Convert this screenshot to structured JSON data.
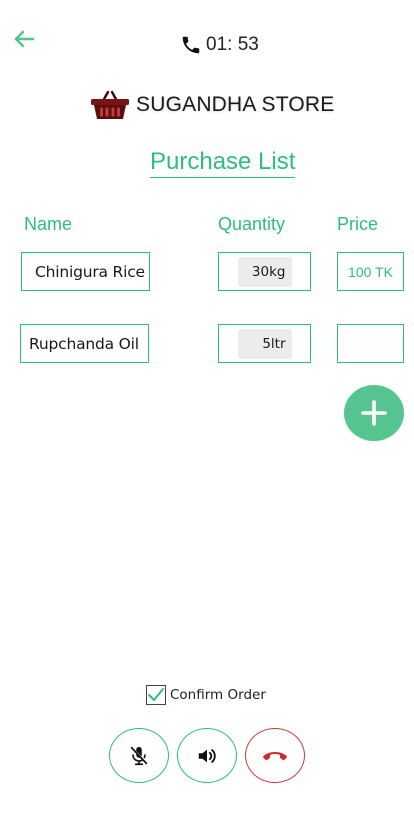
{
  "header": {
    "back_icon": "arrow-left-icon",
    "phone_icon": "phone-icon",
    "call_time": "01: 53"
  },
  "store": {
    "logo_icon": "shopping-basket-icon",
    "name": "SUGANDHA STORE"
  },
  "list": {
    "title": "Purchase List",
    "columns": [
      "Name",
      "Quantity",
      "Price"
    ],
    "items": [
      {
        "name": "Chinigura Rice",
        "quantity": "30kg",
        "price": "100 TK"
      },
      {
        "name": "Rupchanda Oil",
        "quantity": "5ltr",
        "price": ""
      }
    ],
    "add_icon": "plus-icon"
  },
  "confirm": {
    "label": "Confirm Order",
    "checked": true
  },
  "controls": {
    "mute_icon": "mic-off-icon",
    "speaker_icon": "speaker-icon",
    "end_call_icon": "end-call-icon"
  },
  "colors": {
    "accent": "#2ebd7d",
    "add_button": "#55c48f",
    "end_call": "#cc3b3b"
  }
}
